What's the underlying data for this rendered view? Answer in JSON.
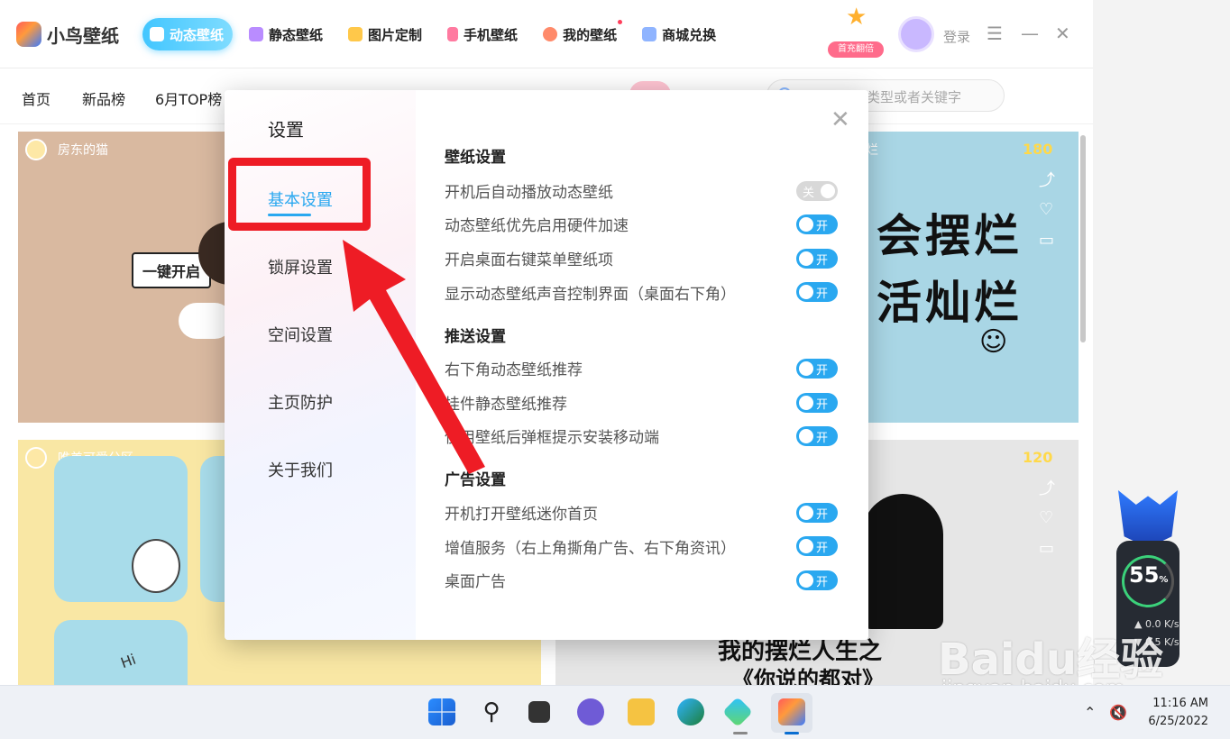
{
  "app": {
    "logo_text": "小鸟壁纸",
    "nav_tabs": [
      {
        "label": "动态壁纸",
        "active": true
      },
      {
        "label": "静态壁纸",
        "active": false
      },
      {
        "label": "图片定制",
        "active": false
      },
      {
        "label": "手机壁纸",
        "active": false
      },
      {
        "label": "我的壁纸",
        "active": false,
        "badge_dot": true
      },
      {
        "label": "商城兑换",
        "active": false
      }
    ],
    "mascot_label": "首充翻倍",
    "login_label": "登录",
    "window_controls": {
      "menu": "☰",
      "minimize": "—",
      "close": "✕"
    },
    "subnav": [
      "首页",
      "新品榜",
      "6月TOP榜"
    ],
    "search_placeholder": "类型或者关键字",
    "cards": [
      {
        "author": "房东的猫",
        "banner_text": "一键开启"
      },
      {
        "author": "烂",
        "price": "180",
        "art_lines": [
          "会摆烂",
          "活灿烂"
        ]
      },
      {
        "author": "唯美可爱分区",
        "art_text": "Hi"
      },
      {
        "price": "120",
        "art_lines": [
          "我的摆烂人生之",
          "《你说的都对》"
        ]
      }
    ]
  },
  "settings": {
    "title": "设置",
    "sidebar": [
      "基本设置",
      "锁屏设置",
      "空间设置",
      "主页防护",
      "关于我们"
    ],
    "active_index": 0,
    "close_label": "✕",
    "sections": [
      {
        "title": "壁纸设置",
        "options": [
          {
            "label": "开机后自动播放动态壁纸",
            "state": "关",
            "on": false
          },
          {
            "label": "动态壁纸优先启用硬件加速",
            "state": "开",
            "on": true
          },
          {
            "label": "开启桌面右键菜单壁纸项",
            "state": "开",
            "on": true
          },
          {
            "label": "显示动态壁纸声音控制界面（桌面右下角）",
            "state": "开",
            "on": true
          }
        ]
      },
      {
        "title": "推送设置",
        "options": [
          {
            "label": "右下角动态壁纸推荐",
            "state": "开",
            "on": true
          },
          {
            "label": "挂件静态壁纸推荐",
            "state": "开",
            "on": true
          },
          {
            "label": "使用壁纸后弹框提示安装移动端",
            "state": "开",
            "on": true
          }
        ]
      },
      {
        "title": "广告设置",
        "options": [
          {
            "label": "开机打开壁纸迷你首页",
            "state": "开",
            "on": true
          },
          {
            "label": "增值服务（右上角撕角广告、右下角资讯）",
            "state": "开",
            "on": true
          },
          {
            "label": "桌面广告",
            "state": "开",
            "on": true
          }
        ]
      }
    ]
  },
  "widget": {
    "percent": "55",
    "percent_unit": "%",
    "speed_up": "0.0",
    "speed_down": "0.5",
    "speed_unit": "K/s"
  },
  "watermark": {
    "text": "Baidu经验",
    "url": "jingyan.baidu.com"
  },
  "taskbar": {
    "time": "11:16 AM",
    "date": "6/25/2022",
    "tray_chevron": "⌃",
    "tray_volume": "🔇"
  },
  "colors": {
    "accent": "#2aa8f0",
    "annotation": "#ee1c25"
  }
}
